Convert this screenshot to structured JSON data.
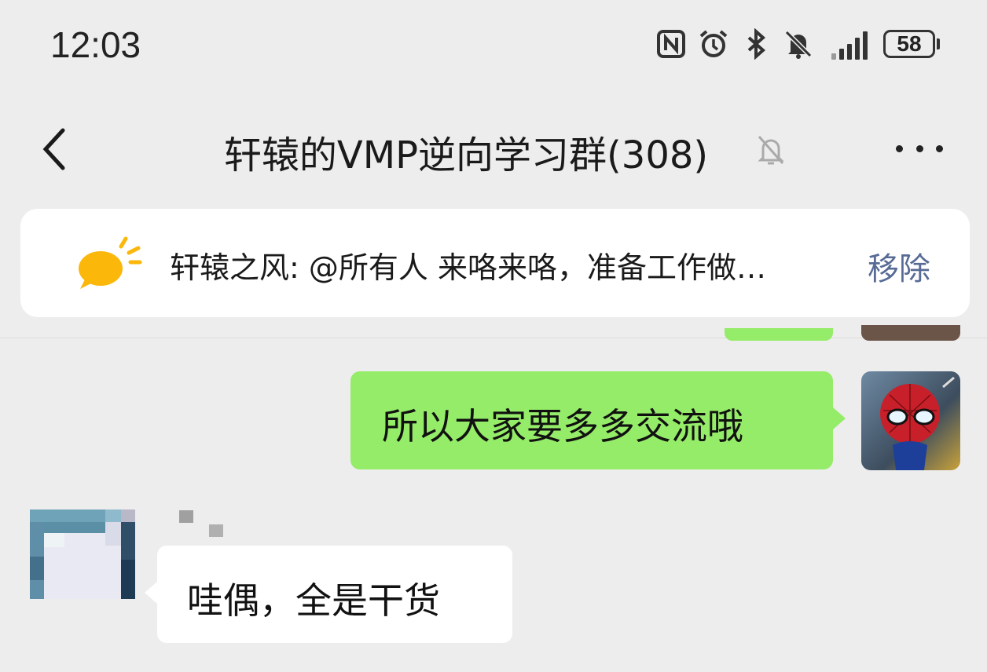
{
  "status_bar": {
    "time": "12:03",
    "icons": [
      "nfc-icon",
      "alarm-icon",
      "bluetooth-icon",
      "notifications-off-icon",
      "signal-icon"
    ],
    "battery": "58"
  },
  "header": {
    "title": "轩辕的VMP逆向学习群(308)",
    "back_icon": "chevron-left-icon",
    "mute_icon": "bell-off-icon",
    "more_icon": "more-dots-icon"
  },
  "announcement": {
    "icon": "announcement-bubble-icon",
    "text": "轩辕之风: @所有人 来咯来咯，准备工作做…",
    "remove_label": "移除",
    "remove_color": "#576b95"
  },
  "messages": [
    {
      "direction": "outgoing",
      "text": "所以大家要多多交流哦",
      "bubble_color": "#95ec69"
    },
    {
      "direction": "incoming",
      "text": "哇偶，全是干货",
      "bubble_color": "#ffffff"
    }
  ]
}
